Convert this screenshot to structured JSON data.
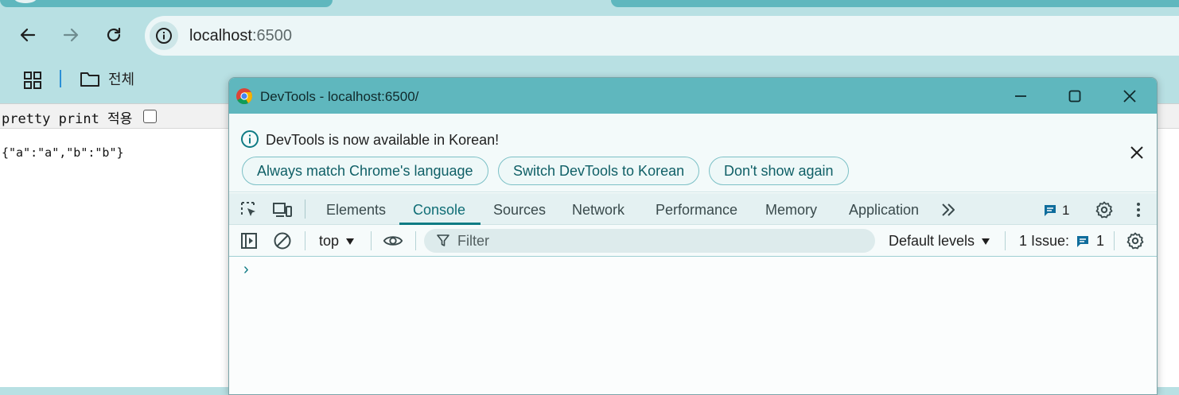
{
  "browser": {
    "url_host": "localhost",
    "url_port": ":6500",
    "bookmarks": {
      "folder_label": "전체"
    }
  },
  "page": {
    "pretty_print_label": "pretty print 적용",
    "json_text": "{\"a\":\"a\",\"b\":\"b\"}"
  },
  "devtools": {
    "window_title": "DevTools - localhost:6500/",
    "infobar": {
      "message": "DevTools is now available in Korean!",
      "buttons": [
        "Always match Chrome's language",
        "Switch DevTools to Korean",
        "Don't show again"
      ]
    },
    "tabs": [
      "Elements",
      "Console",
      "Sources",
      "Network",
      "Performance",
      "Memory",
      "Application"
    ],
    "active_tab": "Console",
    "issues_badge_count": "1",
    "console": {
      "context": "top",
      "filter_placeholder": "Filter",
      "levels_label": "Default levels",
      "issues_label": "1 Issue:",
      "issues_count": "1",
      "prompt_glyph": "›"
    }
  },
  "colors": {
    "accent": "#0f7b84",
    "titlebar": "#5fb7be",
    "toolbar": "#b8e0e3"
  }
}
